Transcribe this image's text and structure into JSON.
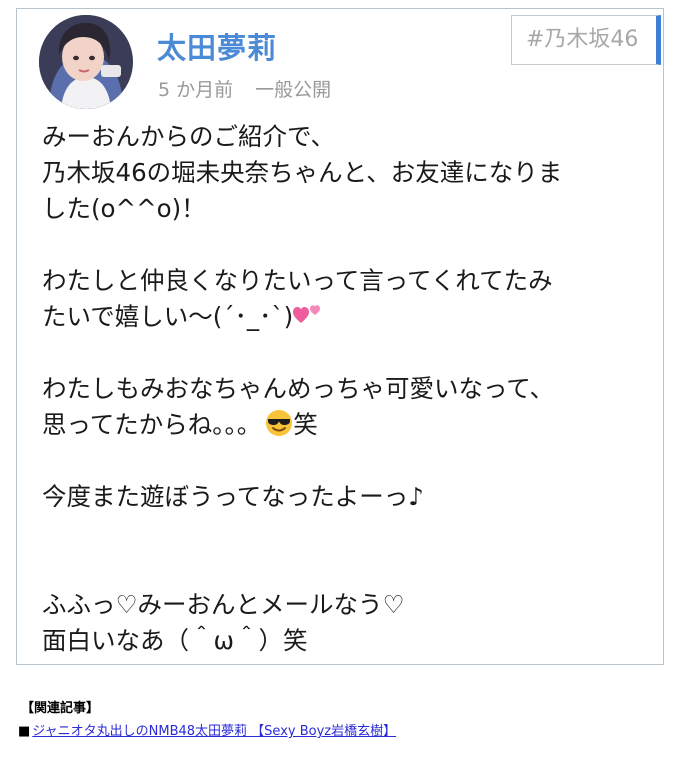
{
  "post": {
    "author": "太田夢莉",
    "time": "5 か月前",
    "visibility": "一般公開",
    "hashtag": "#乃木坂46",
    "lines": {
      "l1": "みーおんからのご紹介で、",
      "l2": "乃木坂46の堀未央奈ちゃんと、お友達になりま",
      "l3": "した(o^^o)！",
      "l4": "わたしと仲良くなりたいって言ってくれてたみ",
      "l5": "たいで嬉しい〜(´･_･`)",
      "l6": "わたしもみおなちゃんめっちゃ可愛いなって、",
      "l7a": "思ってたからね。。。",
      "l7b": "笑",
      "l8": "今度また遊ぼうってなったよーっ♪",
      "l9": "ふふっ♡みーおんとメールなう♡",
      "l10": "面白いなあ（＾ω＾）笑"
    },
    "icons": {
      "heart": "two-hearts-icon",
      "face": "smiling-face-with-sunglasses-icon"
    }
  },
  "related": {
    "heading": "【関連記事】",
    "bullet": "■",
    "link": "ジャニオタ丸出しのNMB48太田夢莉 【Sexy Boyz岩橋玄樹】"
  },
  "colors": {
    "author": "#4b8ad6",
    "tag_accent": "#3f7fd8",
    "link": "#2a2ad8"
  }
}
